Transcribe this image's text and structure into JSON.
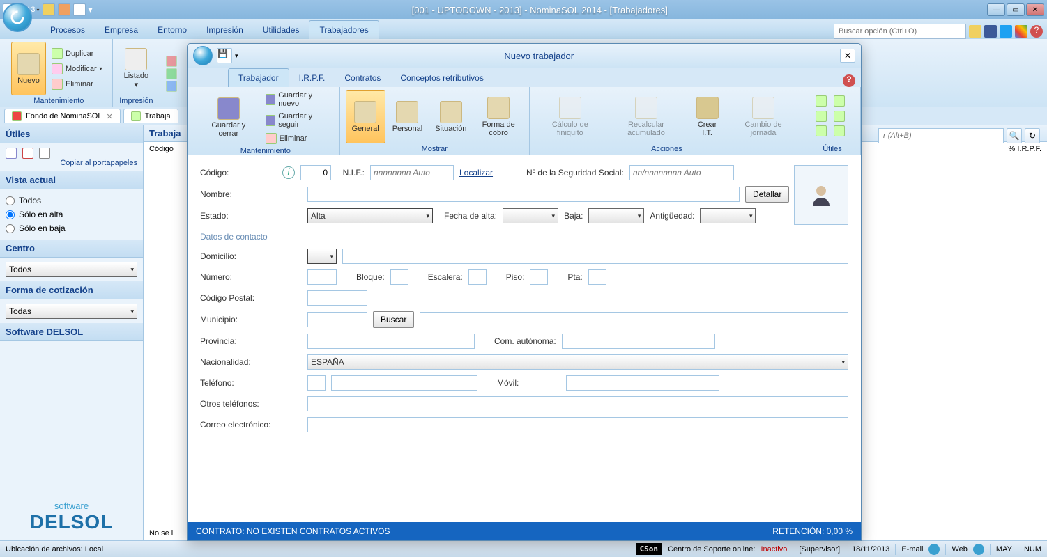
{
  "titlebar": {
    "year": "2013",
    "title": "[001 - UPTODOWN - 2013] - NominaSOL 2014 - [Trabajadores]"
  },
  "ribbon_tabs": [
    "Procesos",
    "Empresa",
    "Entorno",
    "Impresión",
    "Utilidades",
    "Trabajadores"
  ],
  "ribbon_active": 5,
  "search_placeholder": "Buscar opción (Ctrl+O)",
  "ribbon": {
    "nuevo": "Nuevo",
    "duplicar": "Duplicar",
    "modificar": "Modificar",
    "eliminar": "Eliminar",
    "grp1": "Mantenimiento",
    "listado": "Listado",
    "grp2": "Impresión"
  },
  "doc_tabs": [
    {
      "label": "Fondo de NominaSOL",
      "closable": true
    },
    {
      "label": "Trabaja",
      "closable": false
    }
  ],
  "sidebar": {
    "utiles": "Útiles",
    "copylink": "Copiar al portapapeles",
    "vista": "Vista actual",
    "radios": [
      "Todos",
      "Sólo en alta",
      "Sólo en baja"
    ],
    "radio_sel": 1,
    "centro": "Centro",
    "centro_val": "Todos",
    "forma": "Forma de cotización",
    "forma_val": "Todas",
    "software": "Software DELSOL",
    "logo1": "software",
    "logo2": "DELSOL"
  },
  "content": {
    "header": "Trabaja",
    "codigo": "Código",
    "nose": "No se l",
    "buscar_ph": "r (Alt+B)",
    "irpf": "% I.R.P.F."
  },
  "dialog": {
    "title": "Nuevo trabajador",
    "tabs": [
      "Trabajador",
      "I.R.P.F.",
      "Contratos",
      "Conceptos retributivos"
    ],
    "tab_active": 0,
    "ribbon": {
      "guardar_cerrar": "Guardar y cerrar",
      "guardar_nuevo": "Guardar y nuevo",
      "guardar_seguir": "Guardar y seguir",
      "eliminar": "Eliminar",
      "grp1": "Mantenimiento",
      "general": "General",
      "personal": "Personal",
      "situacion": "Situación",
      "forma_cobro": "Forma de cobro",
      "grp2": "Mostrar",
      "calc_finiquito": "Cálculo de finiquito",
      "recalc": "Recalcular acumulado",
      "crear_it": "Crear I.T.",
      "cambio_jornada": "Cambio de jornada",
      "grp3": "Acciones",
      "grp4": "Útiles"
    },
    "form": {
      "codigo_lbl": "Código:",
      "codigo_val": "0",
      "nif_lbl": "N.I.F.:",
      "nif_ph": "nnnnnnnn Auto",
      "localizar": "Localizar",
      "nss_lbl": "Nº de la Seguridad Social:",
      "nss_ph": "nn/nnnnnnnn Auto",
      "nombre_lbl": "Nombre:",
      "detallar": "Detallar",
      "estado_lbl": "Estado:",
      "estado_val": "Alta",
      "fecha_alta_lbl": "Fecha de alta:",
      "baja_lbl": "Baja:",
      "antiguedad_lbl": "Antigüedad:",
      "datos_contacto": "Datos de contacto",
      "domicilio_lbl": "Domicilio:",
      "numero_lbl": "Número:",
      "bloque_lbl": "Bloque:",
      "escalera_lbl": "Escalera:",
      "piso_lbl": "Piso:",
      "pta_lbl": "Pta:",
      "cp_lbl": "Código Postal:",
      "municipio_lbl": "Municipio:",
      "buscar_btn": "Buscar",
      "provincia_lbl": "Provincia:",
      "com_auto_lbl": "Com. autónoma:",
      "nacionalidad_lbl": "Nacionalidad:",
      "nacionalidad_val": "ESPAÑA",
      "telefono_lbl": "Teléfono:",
      "movil_lbl": "Móvil:",
      "otros_tel_lbl": "Otros teléfonos:",
      "correo_lbl": "Correo electrónico:"
    },
    "status": {
      "contract": "CONTRATO: NO EXISTEN CONTRATOS ACTIVOS",
      "retencion": "RETENCIÓN: 0,00 %"
    }
  },
  "statusbar": {
    "loc": "Ubicación de archivos: Local",
    "cson": "CSon",
    "centro": "Centro de Soporte online:",
    "inactive": "Inactivo",
    "supervisor": "[Supervisor]",
    "date": "18/11/2013",
    "email": "E-mail",
    "web": "Web",
    "may": "MAY",
    "num": "NUM"
  }
}
